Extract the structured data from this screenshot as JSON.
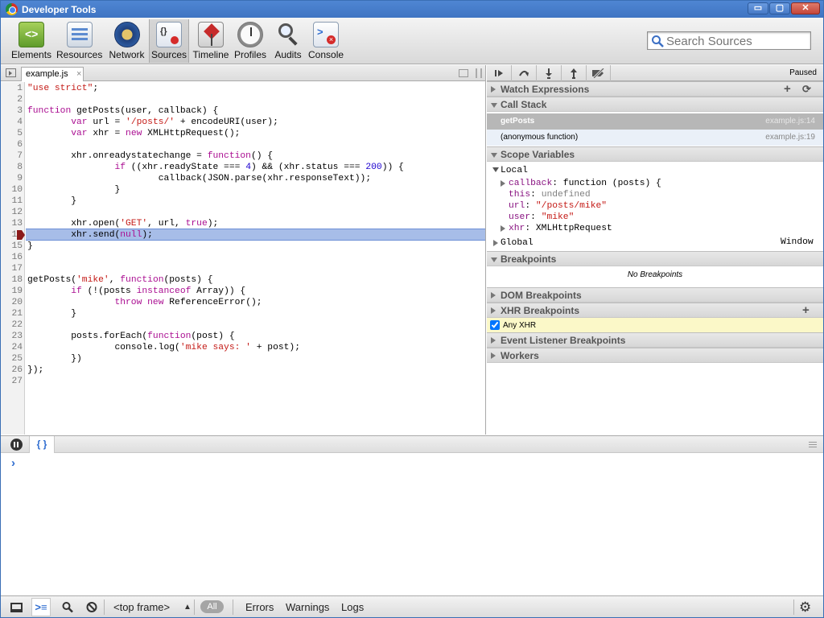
{
  "window": {
    "title": "Developer Tools",
    "min_label": "▭",
    "max_label": "▢",
    "close_label": "✕"
  },
  "toolbar": {
    "tools": [
      {
        "label": "Elements",
        "icon": "elements-icon"
      },
      {
        "label": "Resources",
        "icon": "resources-icon"
      },
      {
        "label": "Network",
        "icon": "network-icon"
      },
      {
        "label": "Sources",
        "icon": "sources-icon",
        "selected": true
      },
      {
        "label": "Timeline",
        "icon": "timeline-icon"
      },
      {
        "label": "Profiles",
        "icon": "profiles-icon"
      },
      {
        "label": "Audits",
        "icon": "audits-icon"
      },
      {
        "label": "Console",
        "icon": "console-icon"
      }
    ],
    "search_placeholder": "Search Sources"
  },
  "editor": {
    "tab_label": "example.js",
    "tab_close": "×",
    "execution_line": 14,
    "breakpoint_line": 14,
    "lines": [
      "\"use strict\";",
      "",
      "function getPosts(user, callback) {",
      "        var url = '/posts/' + encodeURI(user);",
      "        var xhr = new XMLHttpRequest();",
      "",
      "        xhr.onreadystatechange = function() {",
      "                if ((xhr.readyState === 4) && (xhr.status === 200)) {",
      "                        callback(JSON.parse(xhr.responseText));",
      "                }",
      "        }",
      "",
      "        xhr.open('GET', url, true);",
      "        xhr.send(null);",
      "}",
      "",
      "",
      "getPosts('mike', function(posts) {",
      "        if (!(posts instanceof Array)) {",
      "                throw new ReferenceError();",
      "        }",
      "",
      "        posts.forEach(function(post) {",
      "                console.log('mike says: ' + post);",
      "        })",
      "});",
      ""
    ]
  },
  "debugger": {
    "status": "Paused",
    "buttons": [
      "resume-button",
      "step-over-button",
      "step-into-button",
      "step-out-button",
      "deactivate-breakpoints-button"
    ],
    "watch_title": "Watch Expressions",
    "watch_add": "+",
    "watch_refresh": "⟳",
    "callstack_title": "Call Stack",
    "callstack": [
      {
        "name": "getPosts",
        "location": "example.js:14",
        "selected": true
      },
      {
        "name": "(anonymous function)",
        "location": "example.js:19"
      }
    ],
    "scope_title": "Scope Variables",
    "scope_local": "Local",
    "scope_vars": [
      {
        "key": "callback",
        "sep": ": ",
        "value": "function (posts) {",
        "expandable": true,
        "vclass": ""
      },
      {
        "key": "this",
        "sep": ": ",
        "value": "undefined",
        "expandable": false,
        "vclass": "pu"
      },
      {
        "key": "url",
        "sep": ": ",
        "value": "\"/posts/mike\"",
        "expandable": false,
        "vclass": "ps"
      },
      {
        "key": "user",
        "sep": ": ",
        "value": "\"mike\"",
        "expandable": false,
        "vclass": "ps"
      },
      {
        "key": "xhr",
        "sep": ": ",
        "value": "XMLHttpRequest",
        "expandable": true,
        "vclass": ""
      }
    ],
    "scope_global": "Global",
    "scope_global_value": "Window",
    "breakpoints_title": "Breakpoints",
    "no_breakpoints": "No Breakpoints",
    "dom_breakpoints_title": "DOM Breakpoints",
    "xhr_breakpoints_title": "XHR Breakpoints",
    "xhr_add": "+",
    "xhr_any": "Any XHR",
    "xhr_any_checked": true,
    "event_listener_title": "Event Listener Breakpoints",
    "workers_title": "Workers"
  },
  "console": {
    "prompt": "›",
    "format_label": "{ }"
  },
  "statusbar": {
    "frame_select": "<top frame>",
    "filter_all": "All",
    "filter_errors": "Errors",
    "filter_warnings": "Warnings",
    "filter_logs": "Logs"
  },
  "colors": {
    "accent": "#3f74c2",
    "exec_highlight": "#a7bde8",
    "breakpoint": "#8b1a1a",
    "string": "#c41a16",
    "keyword": "#aa0d91",
    "number": "#1c00cf"
  }
}
